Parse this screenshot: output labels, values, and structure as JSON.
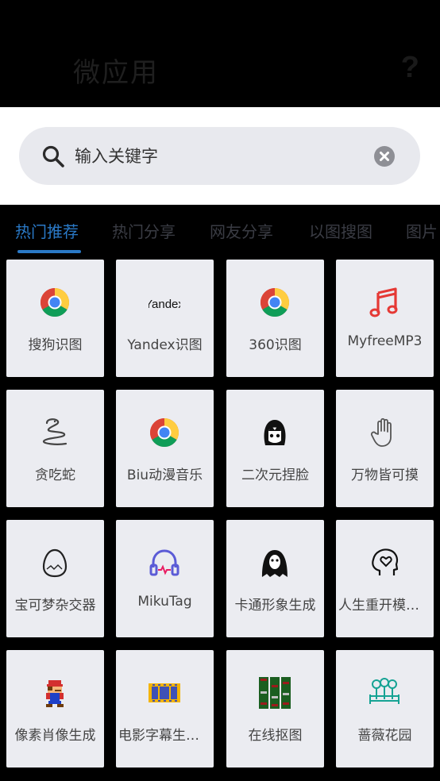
{
  "header": {
    "title": "微应用",
    "help": "?"
  },
  "search": {
    "placeholder": "输入关键字"
  },
  "tabs": [
    "热门推荐",
    "热门分享",
    "网友分享",
    "以图搜图",
    "图片"
  ],
  "apps": [
    {
      "label": "搜狗识图",
      "icon": "chrome-icon"
    },
    {
      "label": "Yandex识图",
      "icon": "yandex-icon",
      "icon_text": "Yandex"
    },
    {
      "label": "360识图",
      "icon": "chrome-icon"
    },
    {
      "label": "MyfreeMP3",
      "icon": "music-note-icon"
    },
    {
      "label": "贪吃蛇",
      "icon": "snake-icon"
    },
    {
      "label": "Biu动漫音乐",
      "icon": "chrome-icon"
    },
    {
      "label": "二次元捏脸",
      "icon": "anime-face-icon"
    },
    {
      "label": "万物皆可摸",
      "icon": "hand-icon"
    },
    {
      "label": "宝可梦杂交器",
      "icon": "egg-icon"
    },
    {
      "label": "MikuTag",
      "icon": "headphones-icon"
    },
    {
      "label": "卡通形象生成",
      "icon": "ghost-icon"
    },
    {
      "label": "人生重开模拟器",
      "icon": "head-heart-icon"
    },
    {
      "label": "像素肖像生成",
      "icon": "pixel-mario-icon"
    },
    {
      "label": "电影字幕生成器",
      "icon": "film-icon"
    },
    {
      "label": "在线抠图",
      "icon": "cutout-icon"
    },
    {
      "label": "蔷薇花园",
      "icon": "garden-icon"
    }
  ]
}
